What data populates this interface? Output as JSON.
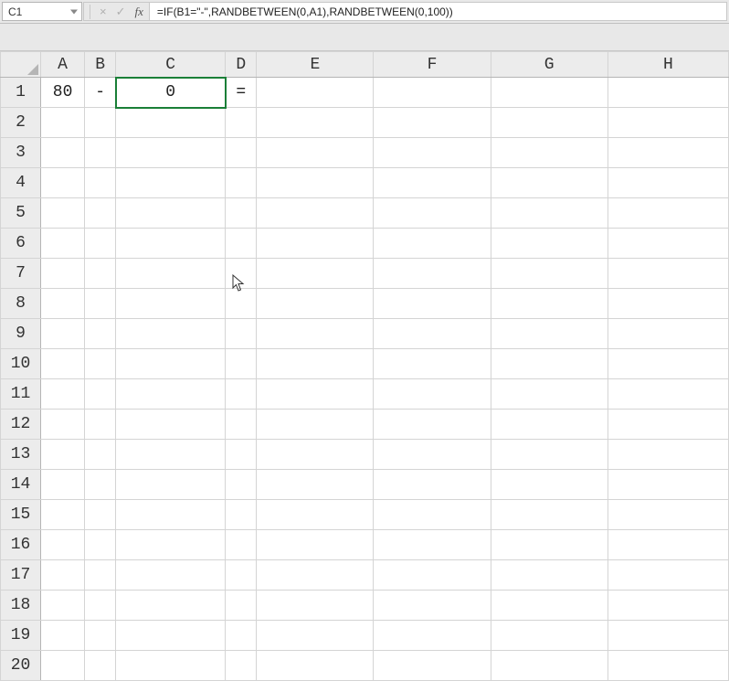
{
  "nameBox": {
    "value": "C1"
  },
  "formulaBar": {
    "cancelGlyph": "×",
    "enterGlyph": "✓",
    "fxLabel": "fx",
    "formula": "=IF(B1=\"-\",RANDBETWEEN(0,A1),RANDBETWEEN(0,100))"
  },
  "columns": [
    "A",
    "B",
    "C",
    "D",
    "E",
    "F",
    "G",
    "H"
  ],
  "rowCount": 20,
  "activeCell": {
    "row": 1,
    "col": "C"
  },
  "cells": {
    "A1": "80",
    "B1": "-",
    "C1": "0",
    "D1": "="
  }
}
